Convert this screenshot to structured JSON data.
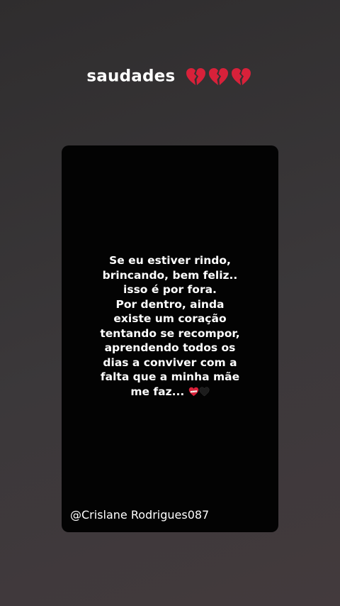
{
  "story": {
    "title": "saudades",
    "title_emoji": [
      "broken-heart-icon",
      "broken-heart-icon",
      "broken-heart-icon"
    ],
    "quote_lines": [
      "Se eu estiver rindo,",
      "brincando, bem feliz..",
      "isso é por fora.",
      "Por dentro, ainda",
      "existe um coração",
      "tentando se recompor,",
      "aprendendo todos os",
      "dias a conviver com a",
      "falta que a minha mãe",
      "me faz..."
    ],
    "quote_end_emoji": [
      "mending-heart-icon",
      "black-heart-icon"
    ],
    "handle": "@Crislane Rodrigues087"
  },
  "colors": {
    "background": "#353234",
    "card": "#030303",
    "text": "#ffffff",
    "heart_red": "#d8213a"
  }
}
